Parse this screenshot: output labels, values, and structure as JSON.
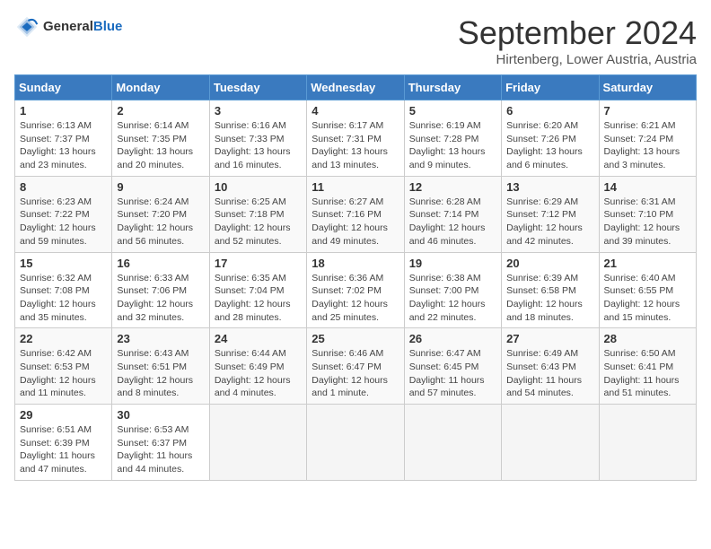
{
  "header": {
    "logo_general": "General",
    "logo_blue": "Blue",
    "main_title": "September 2024",
    "subtitle": "Hirtenberg, Lower Austria, Austria"
  },
  "calendar": {
    "days_of_week": [
      "Sunday",
      "Monday",
      "Tuesday",
      "Wednesday",
      "Thursday",
      "Friday",
      "Saturday"
    ],
    "weeks": [
      [
        {
          "day": "",
          "info": ""
        },
        {
          "day": "2",
          "info": "Sunrise: 6:14 AM\nSunset: 7:35 PM\nDaylight: 13 hours\nand 20 minutes."
        },
        {
          "day": "3",
          "info": "Sunrise: 6:16 AM\nSunset: 7:33 PM\nDaylight: 13 hours\nand 16 minutes."
        },
        {
          "day": "4",
          "info": "Sunrise: 6:17 AM\nSunset: 7:31 PM\nDaylight: 13 hours\nand 13 minutes."
        },
        {
          "day": "5",
          "info": "Sunrise: 6:19 AM\nSunset: 7:28 PM\nDaylight: 13 hours\nand 9 minutes."
        },
        {
          "day": "6",
          "info": "Sunrise: 6:20 AM\nSunset: 7:26 PM\nDaylight: 13 hours\nand 6 minutes."
        },
        {
          "day": "7",
          "info": "Sunrise: 6:21 AM\nSunset: 7:24 PM\nDaylight: 13 hours\nand 3 minutes."
        }
      ],
      [
        {
          "day": "1",
          "info": "Sunrise: 6:13 AM\nSunset: 7:37 PM\nDaylight: 13 hours\nand 23 minutes."
        },
        {
          "day": "",
          "info": ""
        },
        {
          "day": "",
          "info": ""
        },
        {
          "day": "",
          "info": ""
        },
        {
          "day": "",
          "info": ""
        },
        {
          "day": "",
          "info": ""
        },
        {
          "day": "",
          "info": ""
        }
      ],
      [
        {
          "day": "8",
          "info": "Sunrise: 6:23 AM\nSunset: 7:22 PM\nDaylight: 12 hours\nand 59 minutes."
        },
        {
          "day": "9",
          "info": "Sunrise: 6:24 AM\nSunset: 7:20 PM\nDaylight: 12 hours\nand 56 minutes."
        },
        {
          "day": "10",
          "info": "Sunrise: 6:25 AM\nSunset: 7:18 PM\nDaylight: 12 hours\nand 52 minutes."
        },
        {
          "day": "11",
          "info": "Sunrise: 6:27 AM\nSunset: 7:16 PM\nDaylight: 12 hours\nand 49 minutes."
        },
        {
          "day": "12",
          "info": "Sunrise: 6:28 AM\nSunset: 7:14 PM\nDaylight: 12 hours\nand 46 minutes."
        },
        {
          "day": "13",
          "info": "Sunrise: 6:29 AM\nSunset: 7:12 PM\nDaylight: 12 hours\nand 42 minutes."
        },
        {
          "day": "14",
          "info": "Sunrise: 6:31 AM\nSunset: 7:10 PM\nDaylight: 12 hours\nand 39 minutes."
        }
      ],
      [
        {
          "day": "15",
          "info": "Sunrise: 6:32 AM\nSunset: 7:08 PM\nDaylight: 12 hours\nand 35 minutes."
        },
        {
          "day": "16",
          "info": "Sunrise: 6:33 AM\nSunset: 7:06 PM\nDaylight: 12 hours\nand 32 minutes."
        },
        {
          "day": "17",
          "info": "Sunrise: 6:35 AM\nSunset: 7:04 PM\nDaylight: 12 hours\nand 28 minutes."
        },
        {
          "day": "18",
          "info": "Sunrise: 6:36 AM\nSunset: 7:02 PM\nDaylight: 12 hours\nand 25 minutes."
        },
        {
          "day": "19",
          "info": "Sunrise: 6:38 AM\nSunset: 7:00 PM\nDaylight: 12 hours\nand 22 minutes."
        },
        {
          "day": "20",
          "info": "Sunrise: 6:39 AM\nSunset: 6:58 PM\nDaylight: 12 hours\nand 18 minutes."
        },
        {
          "day": "21",
          "info": "Sunrise: 6:40 AM\nSunset: 6:55 PM\nDaylight: 12 hours\nand 15 minutes."
        }
      ],
      [
        {
          "day": "22",
          "info": "Sunrise: 6:42 AM\nSunset: 6:53 PM\nDaylight: 12 hours\nand 11 minutes."
        },
        {
          "day": "23",
          "info": "Sunrise: 6:43 AM\nSunset: 6:51 PM\nDaylight: 12 hours\nand 8 minutes."
        },
        {
          "day": "24",
          "info": "Sunrise: 6:44 AM\nSunset: 6:49 PM\nDaylight: 12 hours\nand 4 minutes."
        },
        {
          "day": "25",
          "info": "Sunrise: 6:46 AM\nSunset: 6:47 PM\nDaylight: 12 hours\nand 1 minute."
        },
        {
          "day": "26",
          "info": "Sunrise: 6:47 AM\nSunset: 6:45 PM\nDaylight: 11 hours\nand 57 minutes."
        },
        {
          "day": "27",
          "info": "Sunrise: 6:49 AM\nSunset: 6:43 PM\nDaylight: 11 hours\nand 54 minutes."
        },
        {
          "day": "28",
          "info": "Sunrise: 6:50 AM\nSunset: 6:41 PM\nDaylight: 11 hours\nand 51 minutes."
        }
      ],
      [
        {
          "day": "29",
          "info": "Sunrise: 6:51 AM\nSunset: 6:39 PM\nDaylight: 11 hours\nand 47 minutes."
        },
        {
          "day": "30",
          "info": "Sunrise: 6:53 AM\nSunset: 6:37 PM\nDaylight: 11 hours\nand 44 minutes."
        },
        {
          "day": "",
          "info": ""
        },
        {
          "day": "",
          "info": ""
        },
        {
          "day": "",
          "info": ""
        },
        {
          "day": "",
          "info": ""
        },
        {
          "day": "",
          "info": ""
        }
      ]
    ]
  }
}
